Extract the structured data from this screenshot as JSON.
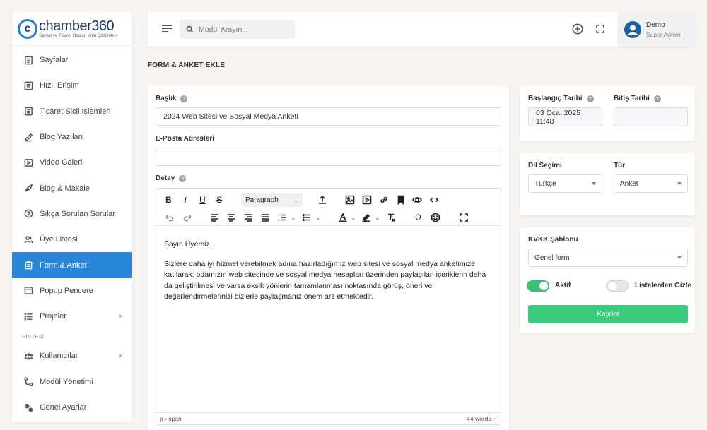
{
  "brand": {
    "name": "chamber",
    "number": "360",
    "tagline": "Sanayi ve Ticaret Odaları Web Çözümleri"
  },
  "sidebar": {
    "items": [
      {
        "label": "Sayfalar",
        "icon": "file-icon"
      },
      {
        "label": "Hızlı Erişim",
        "icon": "list-icon"
      },
      {
        "label": "Ticaret Sicil İşlemleri",
        "icon": "document-icon"
      },
      {
        "label": "Blog Yazıları",
        "icon": "pen-icon"
      },
      {
        "label": "Video Galeri",
        "icon": "video-icon"
      },
      {
        "label": "Blog & Makale",
        "icon": "quill-icon"
      },
      {
        "label": "Sıkça Sorulan Sorular",
        "icon": "question-icon"
      },
      {
        "label": "Üye Listesi",
        "icon": "users-icon"
      },
      {
        "label": "Form & Anket",
        "icon": "clipboard-icon",
        "active": true
      },
      {
        "label": "Popup Pencere",
        "icon": "window-icon"
      },
      {
        "label": "Projeler",
        "icon": "projects-icon",
        "has_children": true
      }
    ],
    "section_label": "SİSTEM",
    "system_items": [
      {
        "label": "Kullanıcılar",
        "icon": "user-group-icon",
        "has_children": true
      },
      {
        "label": "Modül Yönetimi",
        "icon": "modules-icon"
      },
      {
        "label": "Genel Ayarlar",
        "icon": "settings-icon"
      }
    ]
  },
  "topbar": {
    "search_placeholder": "Modül Arayın...",
    "user_name": "Demo",
    "user_role": "Super Admin"
  },
  "page": {
    "title": "FORM & ANKET EKLE"
  },
  "form": {
    "title_label": "Başlık",
    "title_value": "2024 Web Sitesi ve Sosyal Medya Anketi",
    "email_label": "E-Posta Adresleri",
    "email_value": "",
    "detail_label": "Detay",
    "paragraph_format": "Paragraph",
    "content": [
      "Sayın Üyemiz,",
      "Sizlere daha iyi hizmet verebilmek adına hazırladığımız web sitesi ve sosyal medya anketimize katılarak; odamızın web sitesinde ve sosyal medya hesapları üzerinden paylaşılan içeriklerin daha da geliştirilmesi ve varsa eksik yönlerin tamamlanması noktasında görüş, öneri ve değerlendirmelerinizi bizlerle paylaşmanız önem arz etmektedir."
    ],
    "status_path": "p › span",
    "word_count": "44 words"
  },
  "side": {
    "start_label": "Başlangıç Tarihi",
    "start_value": "03 Oca, 2025 11:48",
    "end_label": "Bitiş Tarihi",
    "end_value": "",
    "lang_label": "Dil Seçimi",
    "lang_value": "Türkçe",
    "type_label": "Tür",
    "type_value": "Anket",
    "kvkk_label": "KVKK Şablonu",
    "kvkk_value": "Genel form",
    "active_label": "Aktif",
    "active_on": true,
    "hide_label": "Listelerden Gizle",
    "hide_on": false,
    "save_label": "Kaydet"
  },
  "colors": {
    "accent": "#2a86d8",
    "success": "#3dcb7e",
    "toggle_on": "#35c176"
  }
}
